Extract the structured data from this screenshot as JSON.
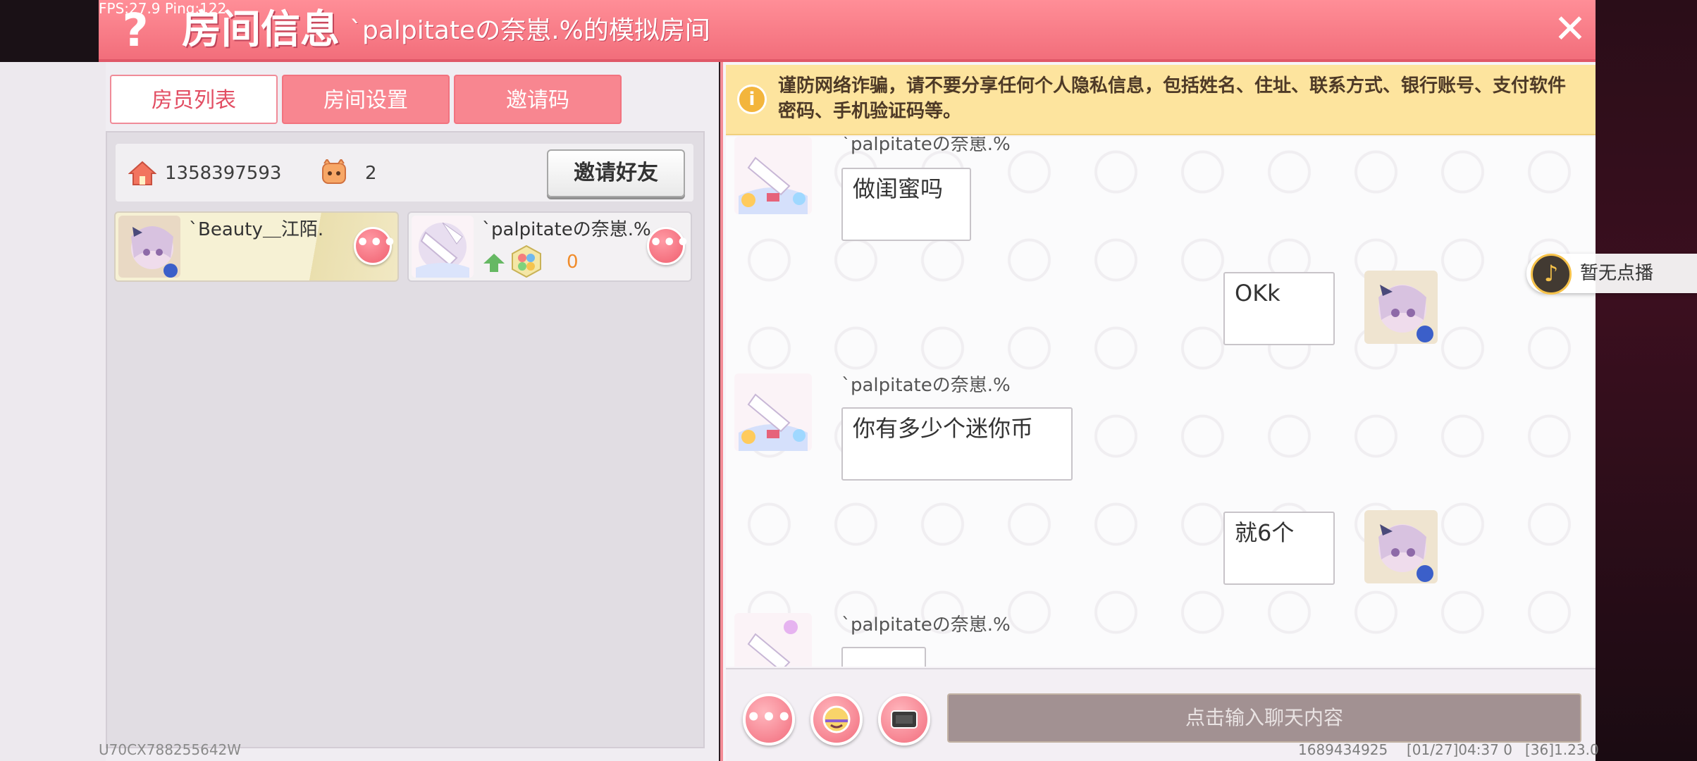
{
  "overlay": {
    "fps_text": "FPS:27.9  Ping:122"
  },
  "header": {
    "title": "房间信息",
    "subtitle": "`palpitateの奈崽.%的模拟房间",
    "help_glyph": "?",
    "close_glyph": "✕"
  },
  "left_panel": {
    "tabs": [
      {
        "label": "房员列表",
        "active": true
      },
      {
        "label": "房间设置",
        "active": false
      },
      {
        "label": "邀请码",
        "active": false
      }
    ],
    "room_id": "1358397593",
    "member_count": "2",
    "invite_button": "邀请好友",
    "members": [
      {
        "name": "`Beauty＿江陌.",
        "more": "•••"
      },
      {
        "name": "`palpitateの奈崽.%",
        "level": "0",
        "more": "•••"
      }
    ],
    "user_code": "U70CX788255642W"
  },
  "warning": {
    "text": "谨防网络诈骗，请不要分享任何个人隐私信息，包括姓名、住址、联系方式、银行账号、支付软件密码、手机验证码等。",
    "icon_glyph": "i"
  },
  "chat": {
    "messages": [
      {
        "side": "left",
        "sender": "`palpitateの奈崽.%",
        "text": "做闺蜜吗"
      },
      {
        "side": "right",
        "sender": "",
        "text": "OKk"
      },
      {
        "side": "left",
        "sender": "`palpitateの奈崽.%",
        "text": "你有多少个迷你币"
      },
      {
        "side": "right",
        "sender": "",
        "text": "就6个"
      },
      {
        "side": "left",
        "sender": "`palpitateの奈崽.%",
        "text": ""
      }
    ]
  },
  "input_bar": {
    "placeholder": "点击输入聊天内容",
    "more_glyph": "•••"
  },
  "status": {
    "uid": "1689434925",
    "datetime": "[01/27]04:37 0",
    "version": "[36]1.23.0"
  },
  "now_playing": {
    "label": "暂无点播",
    "icon_glyph": "♪"
  },
  "colors": {
    "accent": "#f26e7b",
    "warning_bg": "#fde49e",
    "level_orange": "#f08c2a"
  }
}
